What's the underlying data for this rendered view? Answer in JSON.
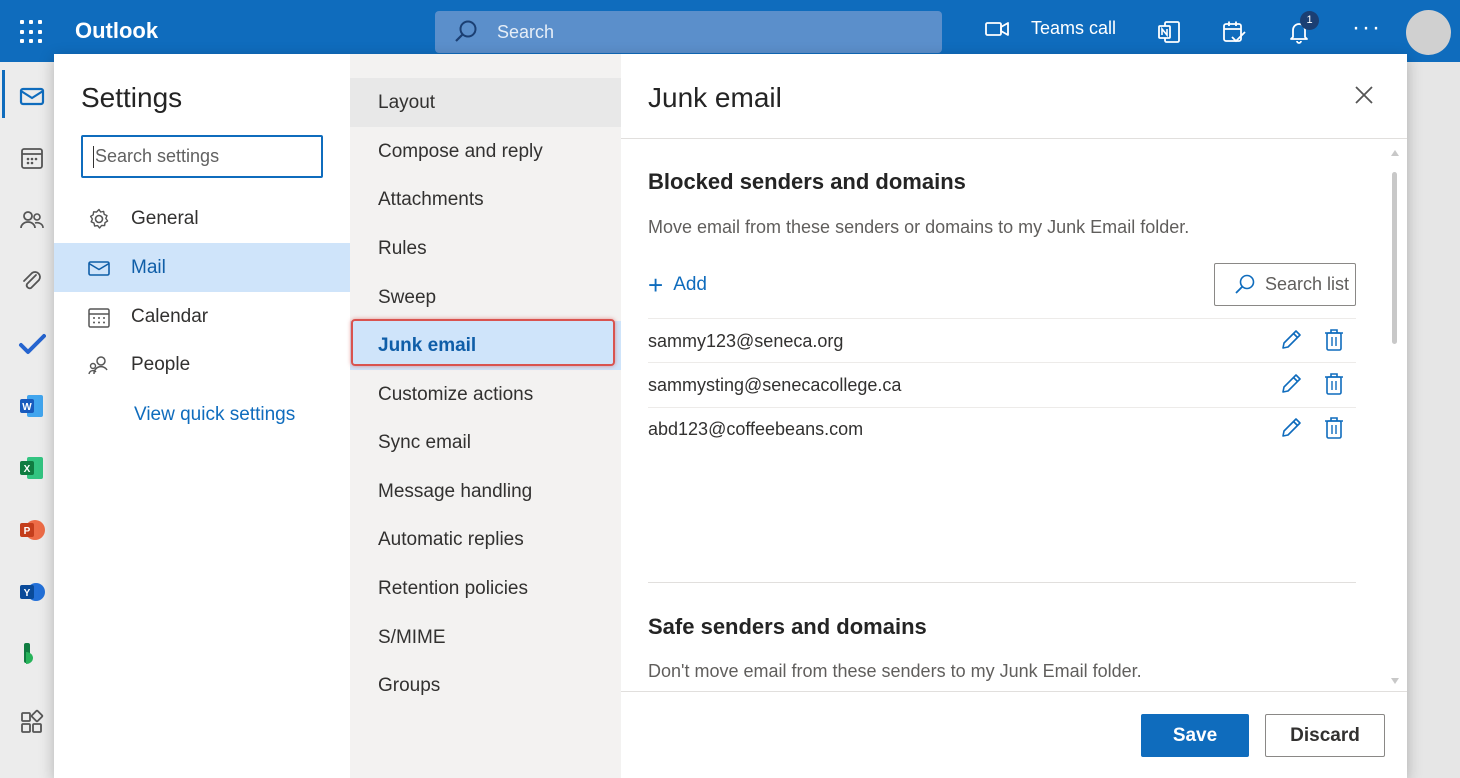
{
  "app": {
    "name": "Outlook"
  },
  "topbar": {
    "search_placeholder": "Search",
    "teams_call_label": "Teams call",
    "notification_count": "1",
    "more_label": "···"
  },
  "rail": {
    "apps": [
      "mail-icon",
      "calendar-icon",
      "people-icon",
      "files-icon",
      "todo-icon",
      "word-icon",
      "excel-icon",
      "powerpoint-icon",
      "yammer-icon",
      "bookings-icon",
      "more-apps-icon"
    ]
  },
  "settings": {
    "title": "Settings",
    "search_placeholder": "Search settings",
    "nav": [
      {
        "label": "General",
        "icon": "gear-icon"
      },
      {
        "label": "Mail",
        "icon": "mail-icon"
      },
      {
        "label": "Calendar",
        "icon": "calendar-icon"
      },
      {
        "label": "People",
        "icon": "people-icon"
      }
    ],
    "quick_settings_label": "View quick settings"
  },
  "mail_submenu": [
    "Layout",
    "Compose and reply",
    "Attachments",
    "Rules",
    "Sweep",
    "Junk email",
    "Customize actions",
    "Sync email",
    "Message handling",
    "Automatic replies",
    "Retention policies",
    "S/MIME",
    "Groups"
  ],
  "junk": {
    "title": "Junk email",
    "blocked": {
      "title": "Blocked senders and domains",
      "description": "Move email from these senders or domains to my Junk Email folder.",
      "add_label": "Add",
      "search_label": "Search list",
      "entries": [
        "sammy123@seneca.org",
        "sammysting@senecacollege.ca",
        "abd123@coffeebeans.com"
      ]
    },
    "safe": {
      "title": "Safe senders and domains",
      "description": "Don't move email from these senders to my Junk Email folder."
    }
  },
  "footer": {
    "save_label": "Save",
    "discard_label": "Discard"
  },
  "colors": {
    "accent": "#0f6cbd",
    "selected_bg": "#cfe4fa",
    "highlight_border": "#d9534f"
  }
}
